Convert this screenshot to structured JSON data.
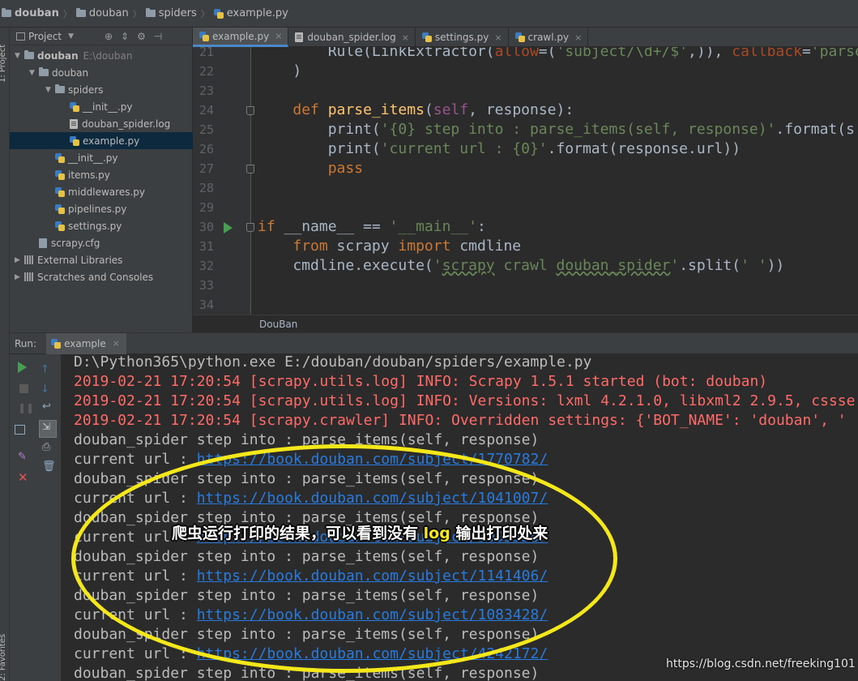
{
  "breadcrumb": [
    "douban",
    "douban",
    "spiders",
    "example.py"
  ],
  "left_strip": {
    "top_label": "1: Project",
    "bottom_label": "2: Favorites"
  },
  "project_panel": {
    "title": "Project",
    "tree": [
      {
        "label": "douban",
        "path": "E:\\douban",
        "icon": "folder-icon",
        "bold": true,
        "expanded": true,
        "depth": 0
      },
      {
        "label": "douban",
        "icon": "folder-icon",
        "expanded": true,
        "depth": 1
      },
      {
        "label": "spiders",
        "icon": "folder-icon",
        "expanded": true,
        "depth": 2
      },
      {
        "label": "__init__.py",
        "icon": "python-file-icon",
        "depth": 3
      },
      {
        "label": "douban_spider.log",
        "icon": "log-file-icon",
        "depth": 3
      },
      {
        "label": "example.py",
        "icon": "python-file-icon",
        "depth": 3,
        "selected": true
      },
      {
        "label": "__init__.py",
        "icon": "python-file-icon",
        "depth": 2
      },
      {
        "label": "items.py",
        "icon": "python-file-icon",
        "depth": 2
      },
      {
        "label": "middlewares.py",
        "icon": "python-file-icon",
        "depth": 2
      },
      {
        "label": "pipelines.py",
        "icon": "python-file-icon",
        "depth": 2
      },
      {
        "label": "settings.py",
        "icon": "python-file-icon",
        "depth": 2
      },
      {
        "label": "scrapy.cfg",
        "icon": "config-file-icon",
        "depth": 1
      },
      {
        "label": "External Libraries",
        "icon": "library-icon",
        "collapsed": true,
        "depth": 0
      },
      {
        "label": "Scratches and Consoles",
        "icon": "scratches-icon",
        "collapsed": true,
        "depth": 0
      }
    ]
  },
  "editor_tabs": [
    {
      "label": "example.py",
      "icon": "python-file-icon",
      "active": true
    },
    {
      "label": "douban_spider.log",
      "icon": "log-file-icon"
    },
    {
      "label": "settings.py",
      "icon": "python-file-icon"
    },
    {
      "label": "crawl.py",
      "icon": "python-file-icon"
    }
  ],
  "editor": {
    "line_numbers": [
      "21",
      "22",
      "23",
      "24",
      "25",
      "26",
      "27",
      "28",
      "29",
      "30",
      "31",
      "32",
      "33",
      "34"
    ],
    "code": [
      "        Rule(LinkExtractor(allow=('subject/\\d+/$',)), callback='parse_",
      "    )",
      "",
      "    def parse_items(self, response):",
      "        print('{0} step into : parse_items(self, response)'.format(s",
      "        print('current url : {0}'.format(response.url))",
      "        pass",
      "",
      "",
      "if __name__ == '__main__':",
      "    from scrapy import cmdline",
      "    cmdline.execute('scrapy crawl douban_spider'.split(' '))",
      "",
      ""
    ],
    "status_text": "DouBan"
  },
  "run": {
    "label": "Run:",
    "tab_label": "example",
    "console": [
      {
        "text": "D:\\Python365\\python.exe E:/douban/douban/spiders/example.py",
        "kind": "normal"
      },
      {
        "text": "2019-02-21 17:20:54 [scrapy.utils.log] INFO: Scrapy 1.5.1 started (bot: douban)",
        "kind": "error"
      },
      {
        "text": "2019-02-21 17:20:54 [scrapy.utils.log] INFO: Versions: lxml 4.2.1.0, libxml2 2.9.5, cssse",
        "kind": "error"
      },
      {
        "text": "2019-02-21 17:20:54 [scrapy.crawler] INFO: Overridden settings: {'BOT_NAME': 'douban', '",
        "kind": "error"
      },
      {
        "text": "douban_spider step into : parse_items(self, response)",
        "kind": "normal"
      },
      {
        "prefix": "current url : ",
        "link": "https://book.douban.com/subject/1770782/",
        "kind": "link"
      },
      {
        "text": "douban_spider step into : parse_items(self, response)",
        "kind": "normal"
      },
      {
        "prefix": "current url : ",
        "link": "https://book.douban.com/subject/1041007/",
        "kind": "link"
      },
      {
        "text": "douban_spider step into : parse_items(self, response)",
        "kind": "normal"
      },
      {
        "prefix": "current url : ",
        "link": "https://book.douban.com/subject/3995526/",
        "kind": "link"
      },
      {
        "text": "douban_spider step into : parse_items(self, response)",
        "kind": "normal"
      },
      {
        "prefix": "current url : ",
        "link": "https://book.douban.com/subject/1141406/",
        "kind": "link"
      },
      {
        "text": "douban_spider step into : parse_items(self, response)",
        "kind": "normal"
      },
      {
        "prefix": "current url : ",
        "link": "https://book.douban.com/subject/1083428/",
        "kind": "link"
      },
      {
        "text": "douban_spider step into : parse_items(self, response)",
        "kind": "normal"
      },
      {
        "prefix": "current url : ",
        "link": "https://book.douban.com/subject/4242172/",
        "kind": "link"
      },
      {
        "text": "douban_spider step into : parse_items(self, response)",
        "kind": "normal"
      }
    ]
  },
  "annotation": {
    "before": "爬虫运行打印的结果，可以看到没有 ",
    "highlight": "log",
    "after": " 输出打印处来",
    "color": "#f5e81a"
  },
  "watermark": "https://blog.csdn.net/freeking101",
  "colors": {
    "background": "#2b2b2b",
    "panel": "#3c3f41",
    "keyword": "#cc7832",
    "string": "#6a8759",
    "function": "#ffc66d",
    "console_error": "#ff6b68",
    "console_link": "#287bde",
    "selection": "#0d293e"
  }
}
